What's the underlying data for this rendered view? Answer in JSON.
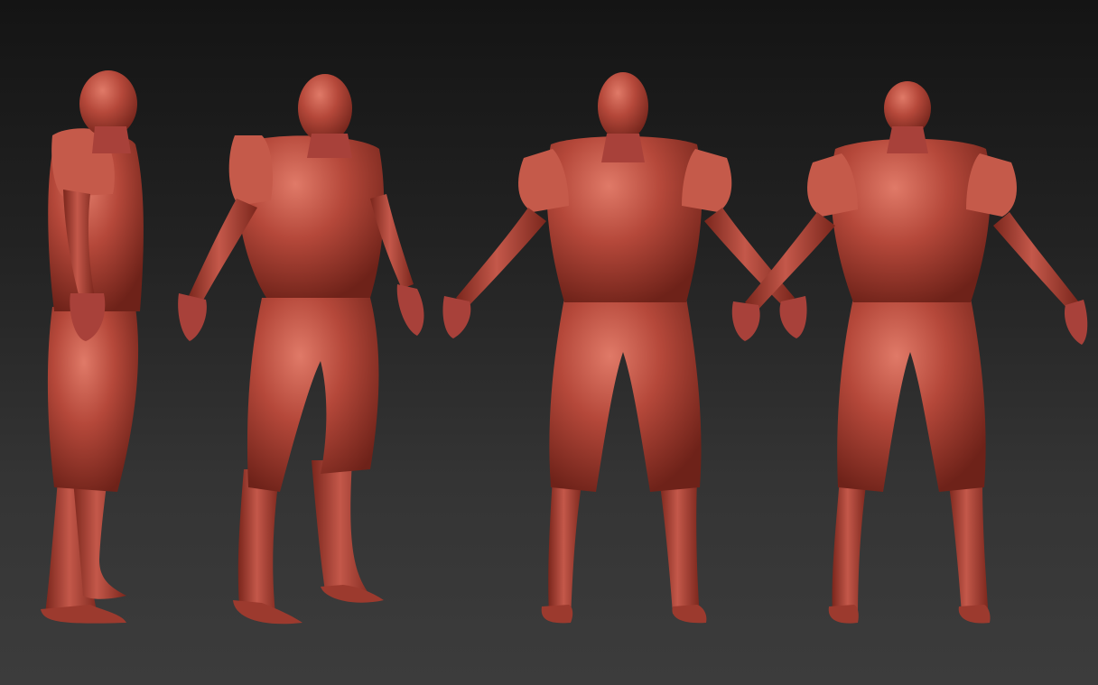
{
  "scene": {
    "background_top": "#141414",
    "background_bottom": "#3c3c3c",
    "material_color": "#b5483a",
    "material_highlight": "#e07a68",
    "material_shadow": "#6e2219",
    "views": [
      {
        "id": "side",
        "description_name": "side-view-figure"
      },
      {
        "id": "three-quarter",
        "description_name": "three-quarter-view-figure"
      },
      {
        "id": "front",
        "description_name": "front-view-figure"
      },
      {
        "id": "back",
        "description_name": "back-view-figure"
      }
    ]
  }
}
